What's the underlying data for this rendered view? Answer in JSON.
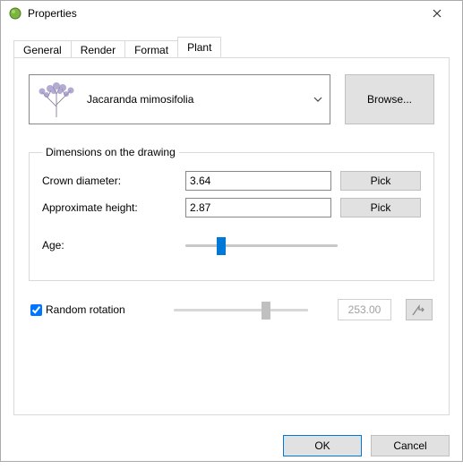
{
  "window": {
    "title": "Properties"
  },
  "tabs": {
    "general": "General",
    "render": "Render",
    "format": "Format",
    "plant": "Plant",
    "active": "plant"
  },
  "plant": {
    "name": "Jacaranda mimosifolia",
    "browse_label": "Browse..."
  },
  "dimensions": {
    "legend": "Dimensions on the drawing",
    "crown_label": "Crown diameter:",
    "crown_value": "3.64",
    "height_label": "Approximate height:",
    "height_value": "2.87",
    "age_label": "Age:",
    "age_percent": 22,
    "pick_label": "Pick"
  },
  "rotation": {
    "checkbox_label": "Random rotation",
    "checked": true,
    "slider_percent": 70,
    "value": "253.00"
  },
  "footer": {
    "ok": "OK",
    "cancel": "Cancel"
  }
}
